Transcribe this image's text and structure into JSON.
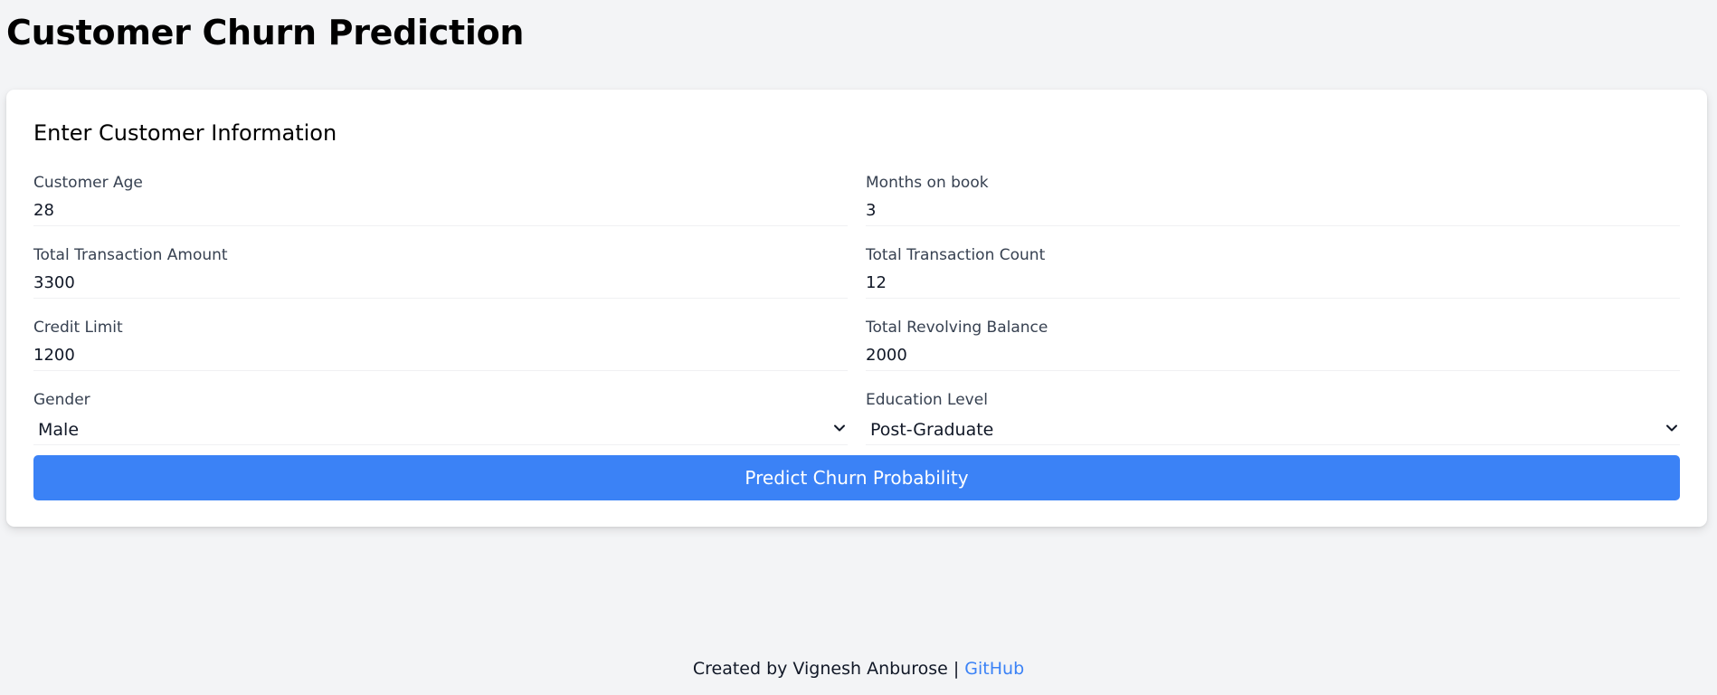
{
  "page": {
    "title": "Customer Churn Prediction"
  },
  "form": {
    "heading": "Enter Customer Information",
    "fields": {
      "customer_age": {
        "label": "Customer Age",
        "value": "28"
      },
      "months_on_book": {
        "label": "Months on book",
        "value": "3"
      },
      "total_trans_amount": {
        "label": "Total Transaction Amount",
        "value": "3300"
      },
      "total_trans_count": {
        "label": "Total Transaction Count",
        "value": "12"
      },
      "credit_limit": {
        "label": "Credit Limit",
        "value": "1200"
      },
      "total_revolving_balance": {
        "label": "Total Revolving Balance",
        "value": "2000"
      },
      "gender": {
        "label": "Gender",
        "value": "Male"
      },
      "education_level": {
        "label": "Education Level",
        "value": "Post-Graduate"
      }
    },
    "submit_label": "Predict Churn Probability"
  },
  "footer": {
    "credit": "Created by Vignesh Anburose | ",
    "link_label": "GitHub"
  },
  "colors": {
    "background": "#f3f4f6",
    "card": "#ffffff",
    "accent": "#3b82f6",
    "label": "#374151"
  },
  "icons": {
    "select_arrow": "chevron-down-icon"
  }
}
